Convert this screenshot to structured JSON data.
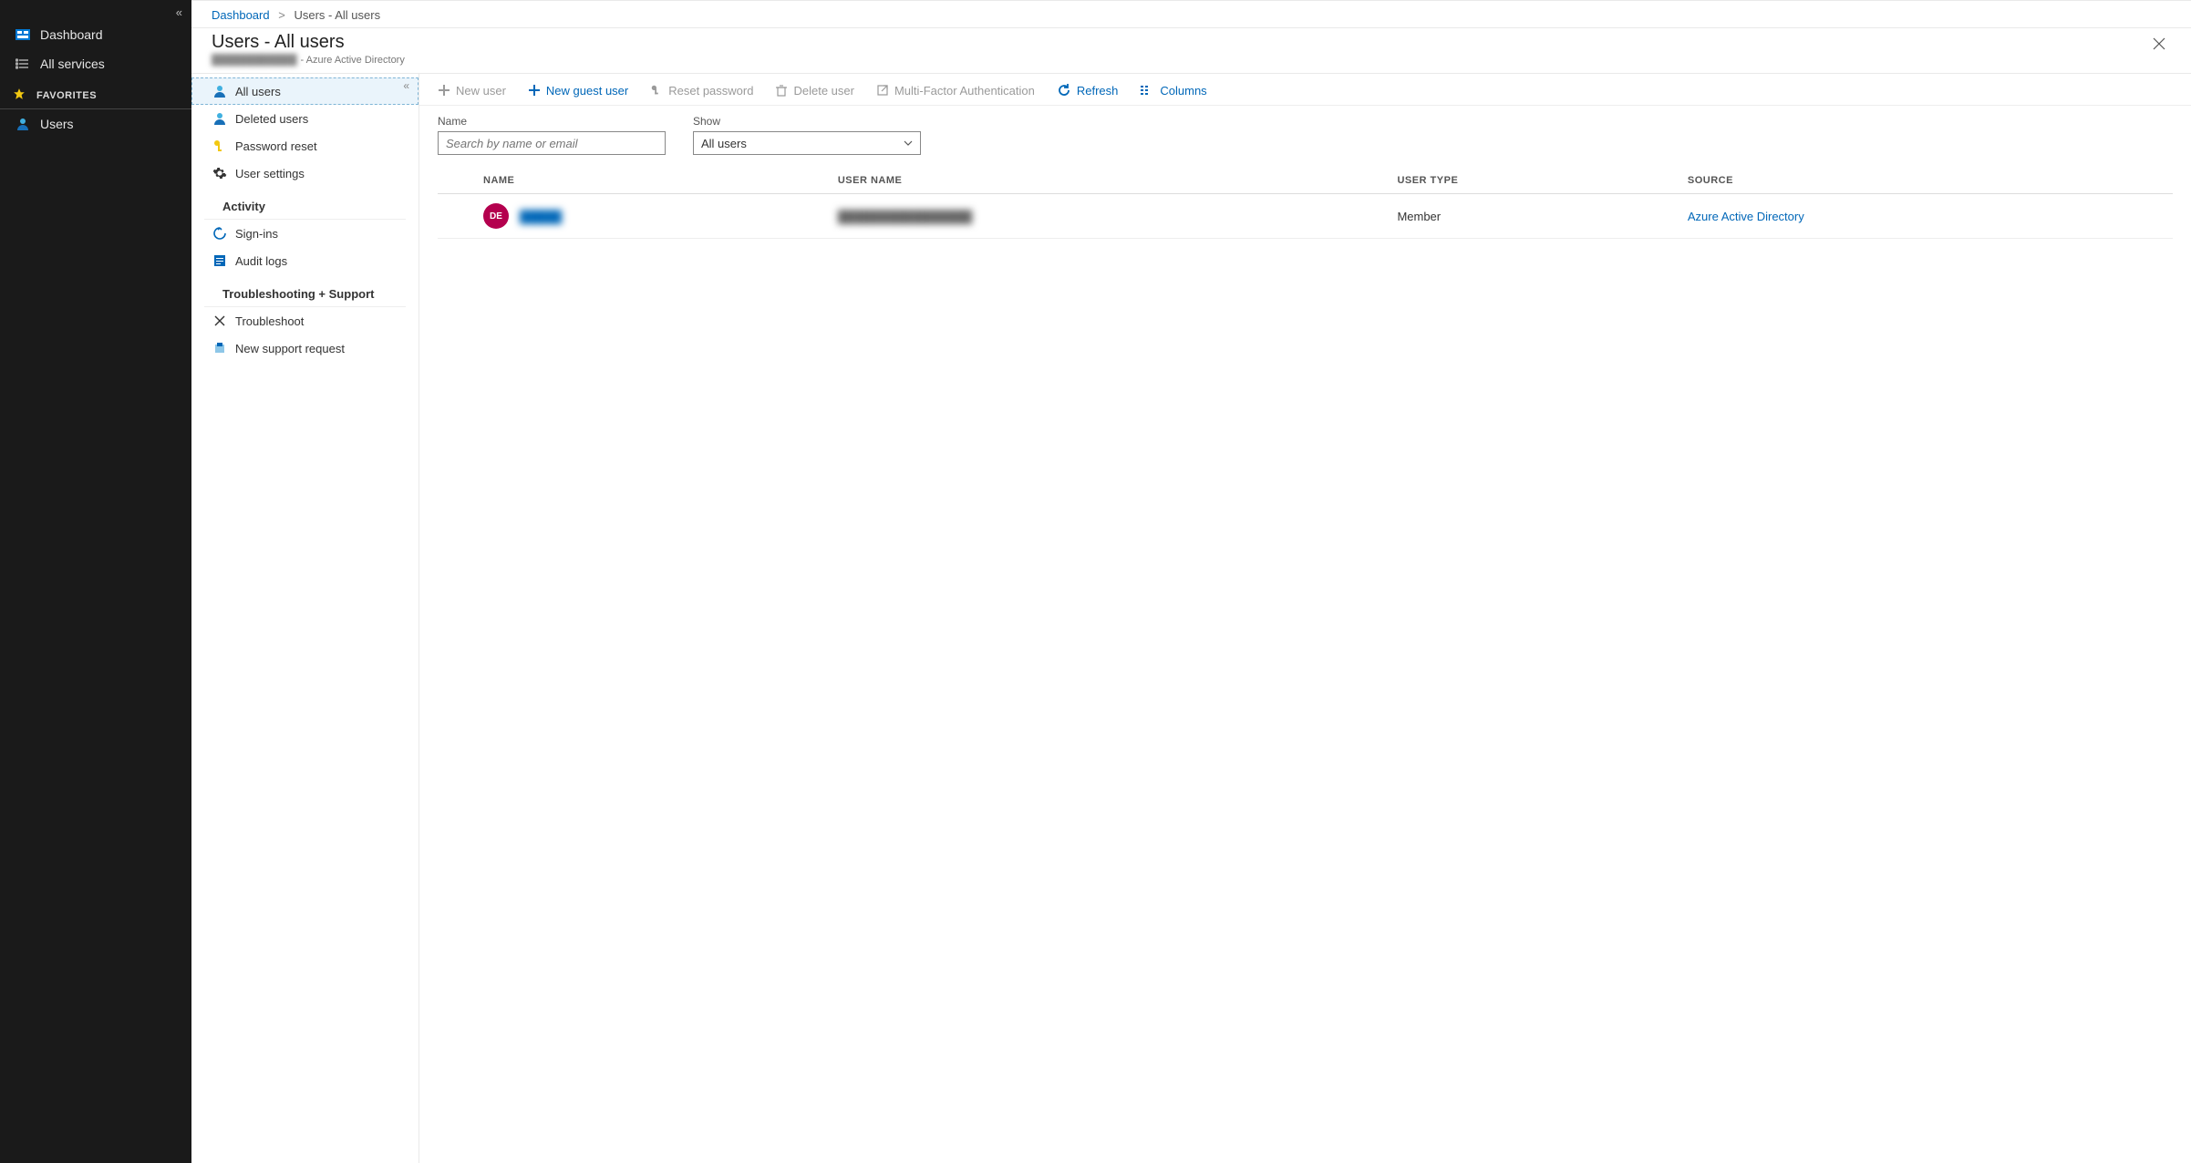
{
  "leftnav": {
    "dashboard": "Dashboard",
    "all_services": "All services",
    "favorites_header": "FAVORITES",
    "users": "Users"
  },
  "breadcrumb": {
    "root": "Dashboard",
    "current": "Users - All users"
  },
  "blade": {
    "title": "Users - All users",
    "tenant_masked": "████████████",
    "subtitle_suffix": "- Azure Active Directory"
  },
  "subnav": {
    "items": [
      {
        "label": "All users"
      },
      {
        "label": "Deleted users"
      },
      {
        "label": "Password reset"
      },
      {
        "label": "User settings"
      }
    ],
    "activity_header": "Activity",
    "activity_items": [
      {
        "label": "Sign-ins"
      },
      {
        "label": "Audit logs"
      }
    ],
    "support_header": "Troubleshooting + Support",
    "support_items": [
      {
        "label": "Troubleshoot"
      },
      {
        "label": "New support request"
      }
    ]
  },
  "toolbar": {
    "new_user": "New user",
    "new_guest": "New guest user",
    "reset_pw": "Reset password",
    "delete": "Delete user",
    "mfa": "Multi-Factor Authentication",
    "refresh": "Refresh",
    "columns": "Columns"
  },
  "filters": {
    "name_label": "Name",
    "name_placeholder": "Search by name or email",
    "show_label": "Show",
    "show_value": "All users"
  },
  "table": {
    "columns": {
      "name": "NAME",
      "user_name": "USER NAME",
      "user_type": "USER TYPE",
      "source": "SOURCE"
    },
    "rows": [
      {
        "avatar_initials": "DE",
        "name_masked": "█████",
        "user_name_masked": "████████████████",
        "user_type": "Member",
        "source": "Azure Active Directory"
      }
    ]
  }
}
